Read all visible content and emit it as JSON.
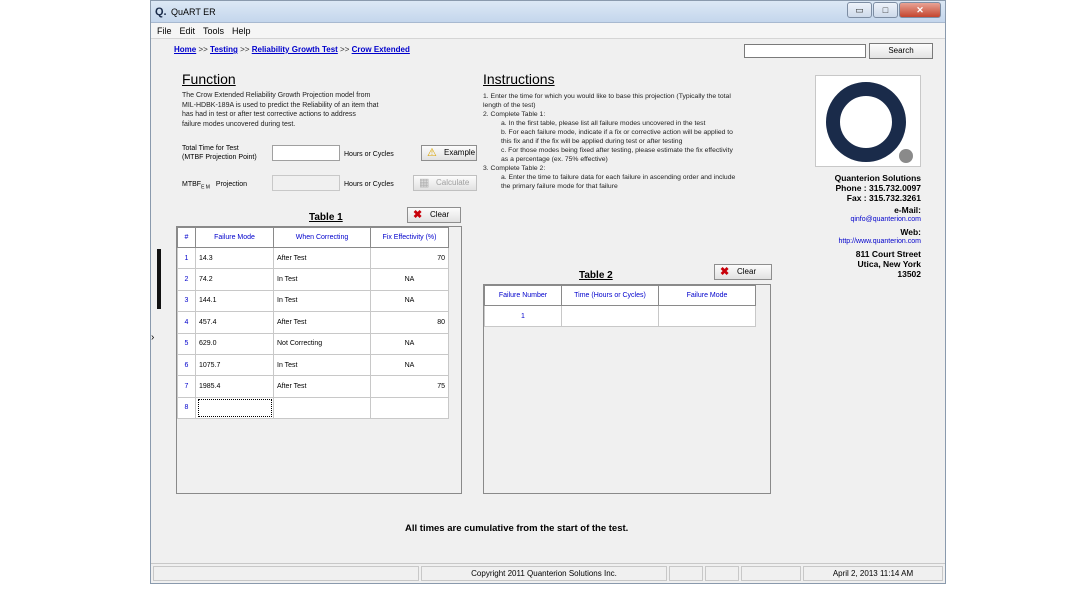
{
  "app": {
    "title": "QuART ER",
    "logo": "Q."
  },
  "window_buttons": {
    "minimize": "▭",
    "maximize": "□",
    "close": "✕"
  },
  "menu": [
    "File",
    "Edit",
    "Tools",
    "Help"
  ],
  "breadcrumb": [
    "Home",
    "Testing",
    "Reliability Growth Test",
    "Crow Extended"
  ],
  "breadcrumb_sep": ">>",
  "search": {
    "value": "",
    "button": "Search"
  },
  "function": {
    "heading": "Function",
    "lines": [
      "The Crow Extended Reliability Growth Projection model from",
      "MIL-HDBK-189A is used to predict the Reliability of an item that",
      "has had in test or after test corrective actions to address",
      "failure modes uncovered during test."
    ]
  },
  "inputs": {
    "total_time_label_1": "Total Time for Test",
    "total_time_label_2": "(MTBF Projection Point)",
    "total_time_value": "",
    "total_time_unit": "Hours or Cycles",
    "mtbf_label": "MTBF",
    "mtbf_sub": "E M",
    "mtbf_suffix": "Projection",
    "mtbf_value": "",
    "mtbf_unit": "Hours or Cycles"
  },
  "buttons": {
    "example": "Example",
    "calculate": "Calculate",
    "clear1": "Clear",
    "clear2": "Clear"
  },
  "instructions": {
    "heading": "Instructions",
    "lines": [
      {
        "indent": 0,
        "text": "1. Enter the time for which you would like to base this projection (Typically the total"
      },
      {
        "indent": 0,
        "text": "length of the test)"
      },
      {
        "indent": 0,
        "text": "2. Complete Table 1:"
      },
      {
        "indent": 1,
        "text": "a. In the first table, please list all failure modes uncovered in the test"
      },
      {
        "indent": 1,
        "text": "b. For each failure mode, indicate if a fix or corrective action will be applied to"
      },
      {
        "indent": 1,
        "text": "this fix and if the fix will be applied during test or after testing"
      },
      {
        "indent": 1,
        "text": "c. For those modes being fixed after testing, please estimate the fix effectivity"
      },
      {
        "indent": 1,
        "text": "as a percentage (ex. 75% effective)"
      },
      {
        "indent": 0,
        "text": "3. Complete Table 2:"
      },
      {
        "indent": 1,
        "text": "a. Enter the time to failure data for each failure in ascending order and include"
      },
      {
        "indent": 1,
        "text": "the primary failure mode for that failure"
      }
    ]
  },
  "table1": {
    "title": "Table 1",
    "headers": [
      "#",
      "Failure Mode",
      "When Correcting",
      "Fix Effectivity (%)"
    ],
    "rows": [
      [
        "1",
        "14.3",
        "After Test",
        "70"
      ],
      [
        "2",
        "74.2",
        "In Test",
        "NA"
      ],
      [
        "3",
        "144.1",
        "In Test",
        "NA"
      ],
      [
        "4",
        "457.4",
        "After Test",
        "80"
      ],
      [
        "5",
        "629.0",
        "Not Correcting",
        "NA"
      ],
      [
        "6",
        "1075.7",
        "In Test",
        "NA"
      ],
      [
        "7",
        "1985.4",
        "After Test",
        "75"
      ],
      [
        "8",
        "",
        "",
        ""
      ]
    ]
  },
  "table2": {
    "title": "Table 2",
    "headers": [
      "Failure Number",
      "Time (Hours or Cycles)",
      "Failure Mode"
    ],
    "rows": [
      [
        "1",
        "",
        ""
      ]
    ]
  },
  "company": {
    "name": "Quanterion Solutions",
    "phone": "Phone : 315.732.0097",
    "fax": "Fax : 315.732.3261",
    "email_label": "e-Mail:",
    "email": "qinfo@quanterion.com",
    "web_label": "Web:",
    "web": "http://www.quanterion.com",
    "addr1": "811 Court Street",
    "addr2": "Utica, New York",
    "addr3": "13502"
  },
  "footer_note": "All times are cumulative from the start of the test.",
  "status": {
    "copyright": "Copyright 2011 Quanterion Solutions Inc.",
    "datetime": "April 2, 2013  11:14 AM"
  },
  "colors": {
    "link": "#0000cc",
    "logo_bg": "#1a2b4a",
    "logo_dot": "#8a8a8a"
  }
}
